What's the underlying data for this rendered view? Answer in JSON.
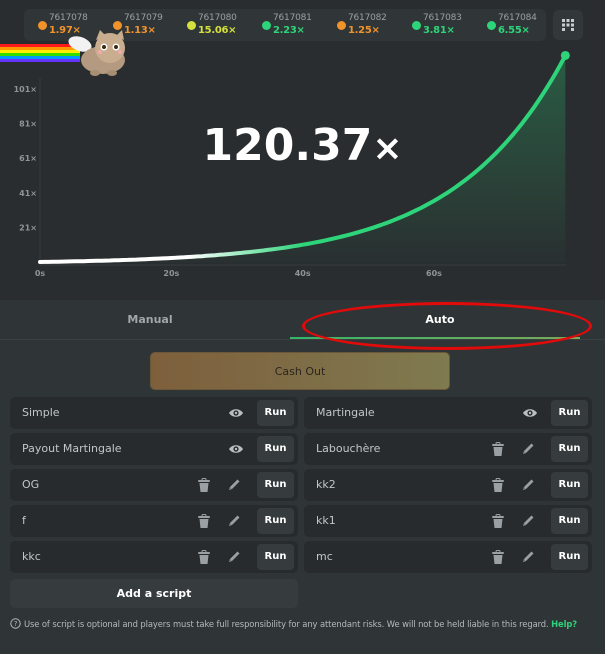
{
  "history": [
    {
      "id": "7617078",
      "value": "1.97×",
      "color": "#f0932b"
    },
    {
      "id": "7617079",
      "value": "1.13×",
      "color": "#f0932b"
    },
    {
      "id": "7617080",
      "value": "15.06×",
      "color": "#d4e03c"
    },
    {
      "id": "7617081",
      "value": "2.23×",
      "color": "#2ed47a"
    },
    {
      "id": "7617082",
      "value": "1.25×",
      "color": "#f0932b"
    },
    {
      "id": "7617083",
      "value": "3.81×",
      "color": "#2ed47a"
    },
    {
      "id": "7617084",
      "value": "6.55×",
      "color": "#2ed47a"
    }
  ],
  "game": {
    "multiplier": "120.37",
    "multiplier_suffix": "×"
  },
  "chart_data": {
    "type": "line",
    "title": "",
    "xlabel": "",
    "ylabel": "",
    "x_ticks": [
      "0s",
      "20s",
      "40s",
      "60s"
    ],
    "y_ticks": [
      "21×",
      "41×",
      "61×",
      "81×",
      "101×"
    ],
    "xlim": [
      0,
      80
    ],
    "ylim": [
      1,
      121
    ],
    "current_time_s": 80,
    "current_multiplier": 120.37,
    "growth": "exponential",
    "line_color_end": "#2ed47a",
    "line_color_start": "#ffffff"
  },
  "tabs": {
    "manual": "Manual",
    "auto": "Auto",
    "active": "auto"
  },
  "cashout_label": "Cash Out",
  "scripts": [
    {
      "name": "Simple",
      "actions": [
        "view"
      ],
      "run": "Run"
    },
    {
      "name": "Martingale",
      "actions": [
        "view"
      ],
      "run": "Run"
    },
    {
      "name": "Payout Martingale",
      "actions": [
        "view"
      ],
      "run": "Run"
    },
    {
      "name": "Labouchère",
      "actions": [
        "delete",
        "edit"
      ],
      "run": "Run"
    },
    {
      "name": "OG",
      "actions": [
        "delete",
        "edit"
      ],
      "run": "Run"
    },
    {
      "name": "kk2",
      "actions": [
        "delete",
        "edit"
      ],
      "run": "Run"
    },
    {
      "name": "f",
      "actions": [
        "delete",
        "edit"
      ],
      "run": "Run"
    },
    {
      "name": "kk1",
      "actions": [
        "delete",
        "edit"
      ],
      "run": "Run"
    },
    {
      "name": "kkc",
      "actions": [
        "delete",
        "edit"
      ],
      "run": "Run"
    },
    {
      "name": "mc",
      "actions": [
        "delete",
        "edit"
      ],
      "run": "Run"
    }
  ],
  "add_script_label": "Add a script",
  "disclaimer": {
    "text": "Use of script is optional and players must take full responsibility for any attendant risks. We will not be held liable in this regard.",
    "help_link": "Help?"
  },
  "colors": {
    "accent_green": "#2ed47a",
    "annotation_red": "#e30a0a"
  }
}
